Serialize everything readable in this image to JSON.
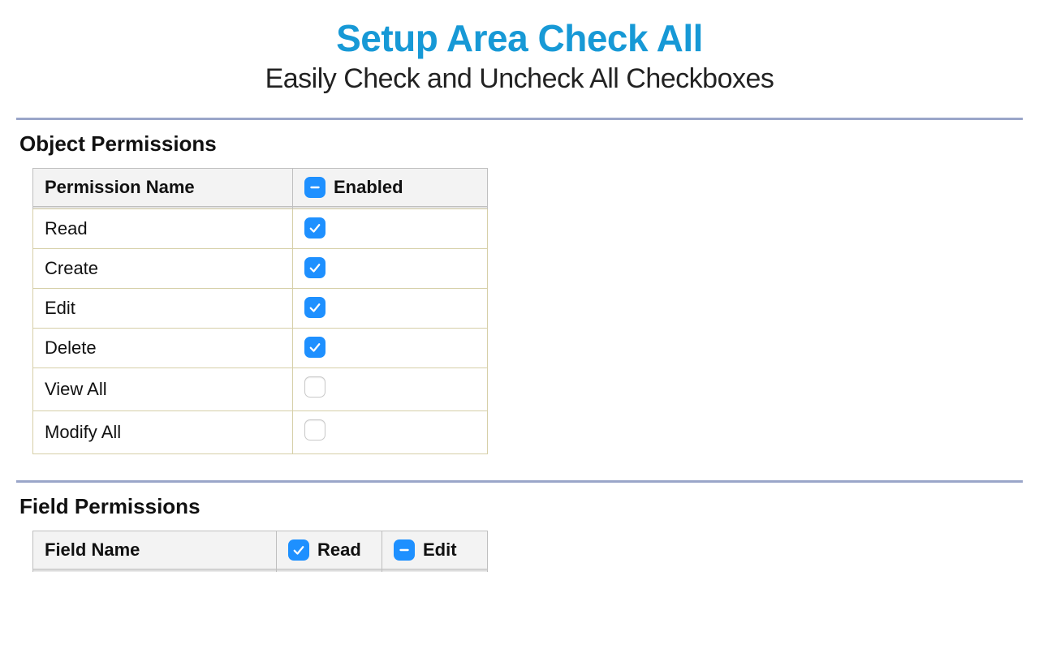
{
  "header": {
    "title": "Setup Area Check All",
    "subtitle": "Easily Check and Uncheck All Checkboxes"
  },
  "sections": {
    "object": {
      "heading": "Object Permissions",
      "columns": {
        "name": "Permission Name",
        "enabled": "Enabled"
      },
      "header_checkbox_state": "indeterminate",
      "rows": [
        {
          "name": "Read",
          "enabled": true
        },
        {
          "name": "Create",
          "enabled": true
        },
        {
          "name": "Edit",
          "enabled": true
        },
        {
          "name": "Delete",
          "enabled": true
        },
        {
          "name": "View All",
          "enabled": false
        },
        {
          "name": "Modify All",
          "enabled": false
        }
      ]
    },
    "field": {
      "heading": "Field Permissions",
      "columns": {
        "name": "Field Name",
        "read": "Read",
        "edit": "Edit"
      },
      "header_checkbox_states": {
        "read": "checked",
        "edit": "indeterminate"
      }
    }
  },
  "colors": {
    "accent": "#1799d6",
    "checkbox": "#1E90FF",
    "divider": "#9aa6c9"
  }
}
